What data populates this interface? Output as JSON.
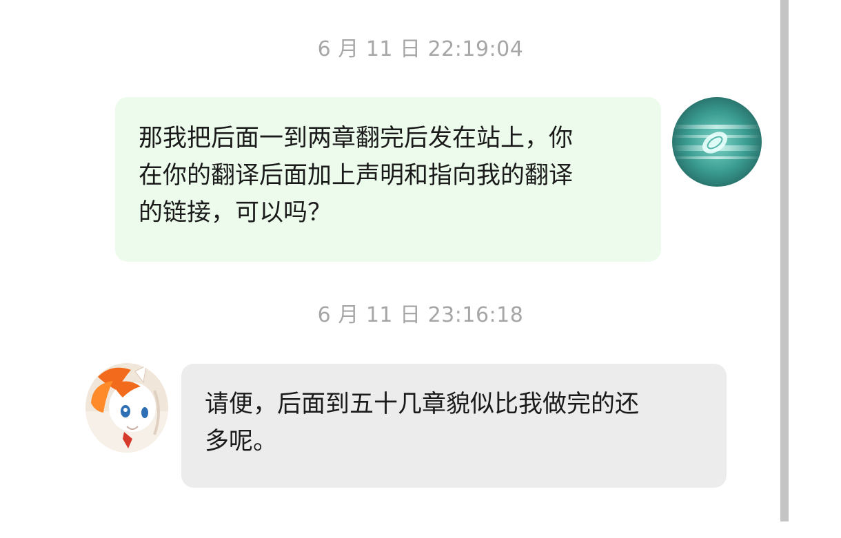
{
  "messages": [
    {
      "timestamp": "6 月 11 日 22:19:04",
      "sender": "self",
      "avatar": "self-avatar-icon",
      "lines": [
        "那我把后面一到两章翻完后发在站上，你",
        "在你的翻译后面加上声明和指向我的翻译",
        "的链接，可以吗？"
      ],
      "bubble_color": "#ecfbec"
    },
    {
      "timestamp": "6 月 11 日 23:16:18",
      "sender": "other",
      "avatar": "pony-avatar-icon",
      "lines": [
        "请便，后面到五十几章貌似比我做完的还",
        "多呢。"
      ],
      "bubble_color": "#ececec"
    }
  ],
  "colors": {
    "timestamp": "#a6a6a6",
    "text": "#1a1a1a",
    "scrollbar": "#c4c4c4"
  }
}
